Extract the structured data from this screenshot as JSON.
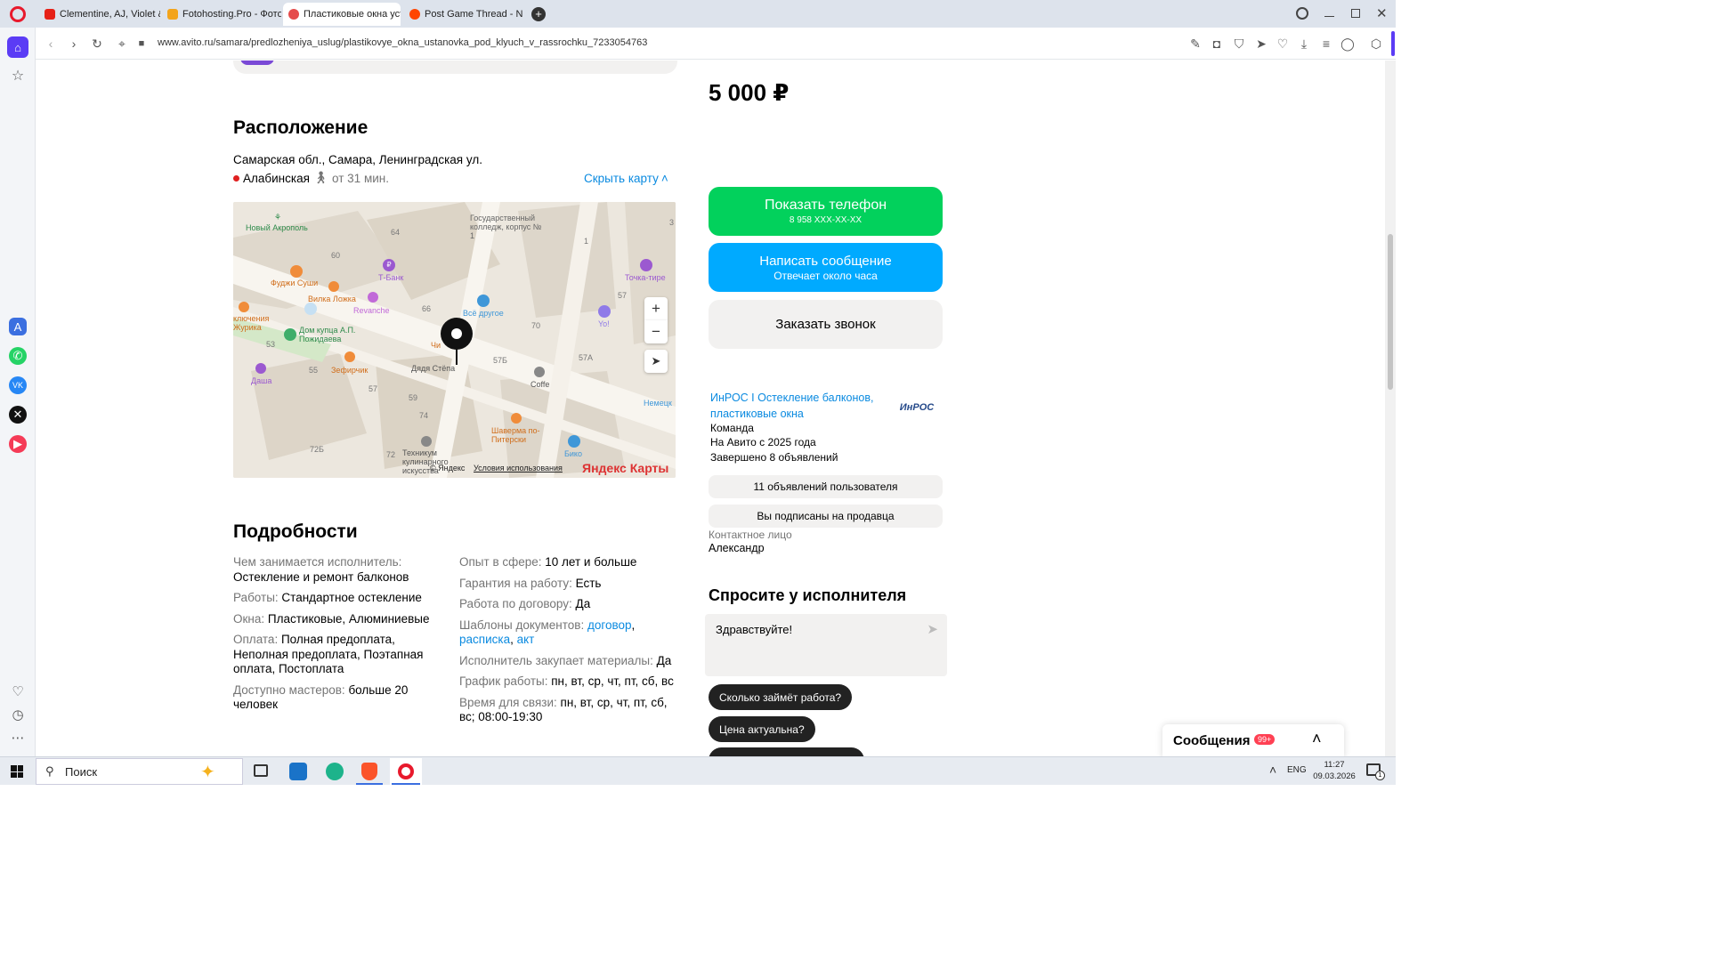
{
  "browser": {
    "tabs": [
      {
        "title": "Clementine, AJ, Violet & L",
        "fav": "#e62117"
      },
      {
        "title": "Fotohosting.Pro - Фотохо",
        "fav": "#f3a41b"
      },
      {
        "title": "Пластиковые окна устан",
        "fav": "#e54b4b"
      },
      {
        "title": "Post Game Thread - NBA:",
        "fav": "#ff4500"
      }
    ],
    "url": "www.avito.ru/samara/predlozheniya_uslug/plastikovye_okna_ustanovka_pod_klyuch_v_rassrochku_7233054763"
  },
  "listing": {
    "price": "5 000 ₽",
    "location": {
      "heading": "Расположение",
      "address": "Самарская обл., Самара, Ленинградская ул.",
      "metro": "Алабинская",
      "metro_color": "#e02020",
      "walk": "от 31 мин.",
      "hide_map": "Скрыть карту"
    },
    "details": {
      "heading": "Подробности",
      "left": [
        {
          "k": "Чем занимается исполнитель:",
          "v": "Остекление и ремонт балконов"
        },
        {
          "k": "Работы:",
          "v": "Стандартное остекление"
        },
        {
          "k": "Окна:",
          "v": "Пластиковые, Алюминиевые"
        },
        {
          "k": "Оплата:",
          "v": "Полная предоплата, Неполная предоплата, Поэтапная оплата, Постоплата"
        },
        {
          "k": "Доступно мастеров:",
          "v": "больше 20 человек"
        }
      ],
      "right": [
        {
          "k": "Опыт в сфере:",
          "v": "10 лет и больше"
        },
        {
          "k": "Гарантия на работу:",
          "v": "Есть"
        },
        {
          "k": "Работа по договору:",
          "v": "Да"
        },
        {
          "k": "Шаблоны документов:",
          "links": [
            "договор",
            "расписка",
            "акт"
          ]
        },
        {
          "k": "Исполнитель закупает материалы:",
          "v": "Да"
        },
        {
          "k": "График работы:",
          "v": "пн, вт, ср, чт, пт, сб, вс"
        },
        {
          "k": "Время для связи:",
          "v": "пн, вт, ср, чт, пт, сб, вс; 08:00-19:30"
        }
      ]
    }
  },
  "map": {
    "labels": [
      "Новый Акрополь",
      "Государственный колледж, корпус № 1",
      "64",
      "1",
      "60",
      "Т-Банк",
      "Точка-тире",
      "Фуджи Суши",
      "Вилка Ложка",
      "Revanche",
      "Всё другое",
      "57",
      "66",
      "Yo!",
      "ключения Журика",
      "Дом купца А.П. Пожидаева",
      "53",
      "70",
      "Чи",
      "57Б",
      "57А",
      "Зефирчик",
      "55",
      "Дядя Стёпа",
      "Coffe",
      "Даша",
      "57",
      "59",
      "Немецк",
      "74",
      "Шаверма по-Питерски",
      "72Б",
      "Техникум кулинарного искусства",
      "72",
      "Бико",
      "3"
    ],
    "copyright": "© Яндекс",
    "terms": "Условия использования",
    "brand": "Яндекс Карты",
    "zoom_in": "+",
    "zoom_out": "−"
  },
  "actions": {
    "show_phone": "Показать телефон",
    "phone_masked": "8 958 XXX-XX-XX",
    "write": "Написать сообщение",
    "write_sub": "Отвечает около часа",
    "call": "Заказать звонок"
  },
  "seller": {
    "name": "ИнРОС I Остекление балконов, пластиковые окна",
    "logo": "ИнРОС",
    "type": "Команда",
    "since": "На Авито с 2025 года",
    "completed": "Завершено 8 объявлений",
    "ads_button": "11 объявлений пользователя",
    "subscribed_button": "Вы подписаны на продавца",
    "contact_label": "Контактное лицо",
    "contact_name": "Александр"
  },
  "ask": {
    "heading": "Спросите у исполнителя",
    "message": "Здравствуйте!",
    "chips": [
      "Сколько займёт работа?",
      "Цена актуальна?"
    ]
  },
  "messages": {
    "label": "Сообщения",
    "badge": "99+"
  },
  "taskbar": {
    "search": "Поиск",
    "lang": "ENG",
    "time": "11:27",
    "date": "09.03.2026",
    "notif": "1"
  }
}
